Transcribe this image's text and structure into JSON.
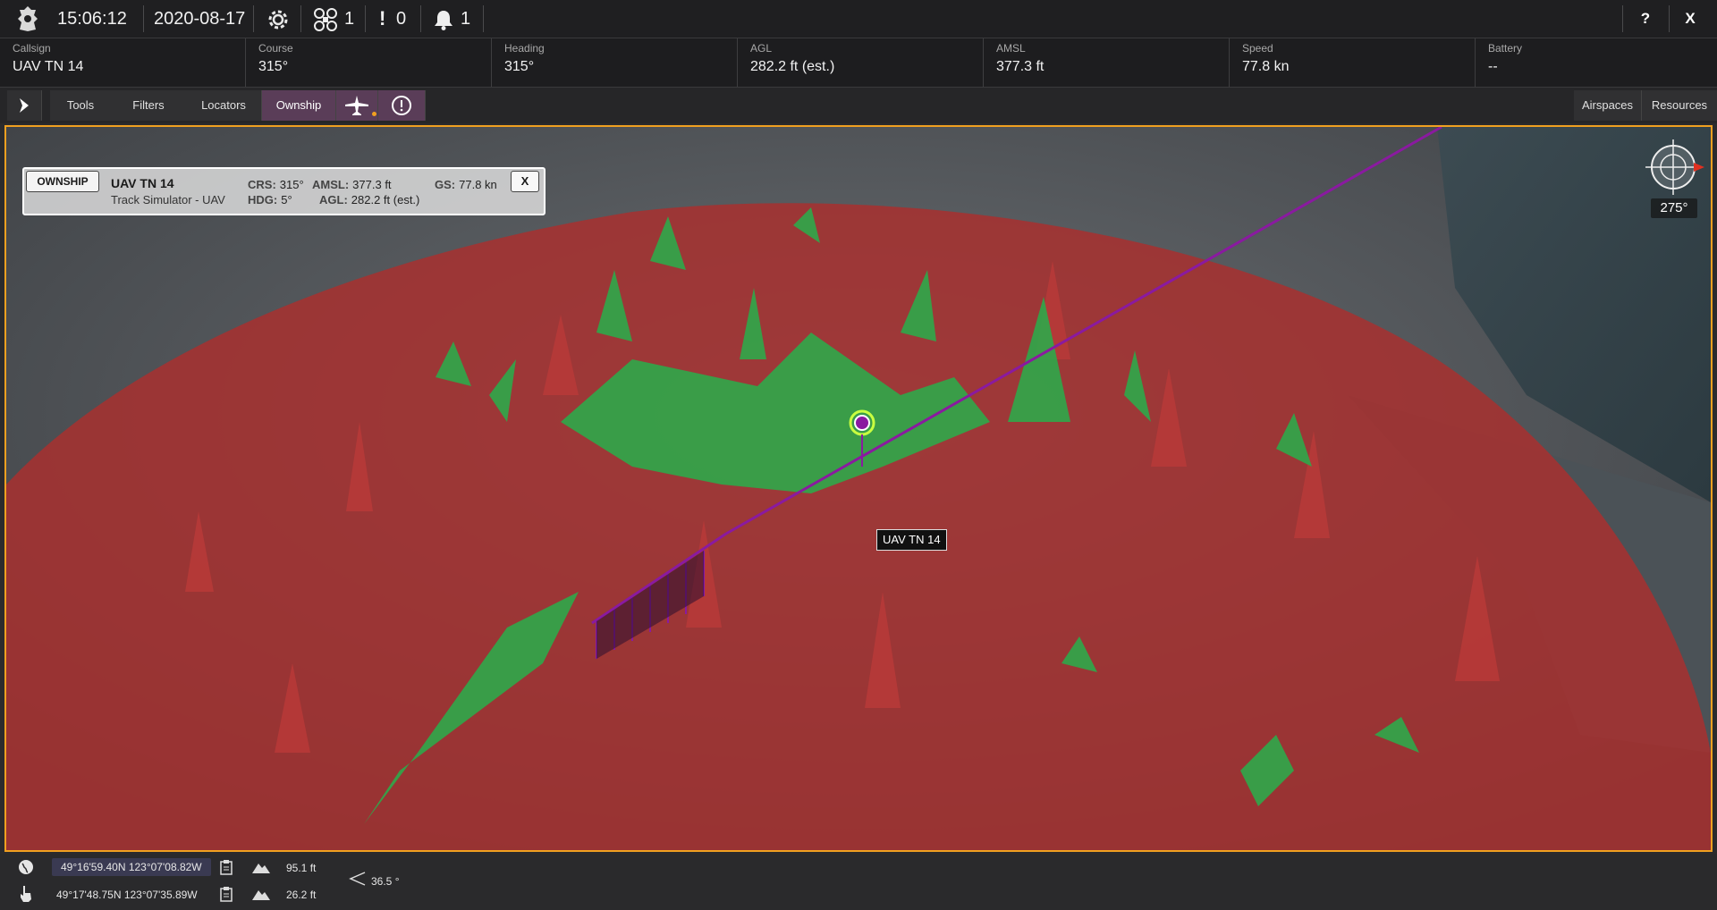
{
  "topbar": {
    "time": "15:06:12",
    "date": "2020-08-17",
    "drone_count": "1",
    "alert_count": "0",
    "notification_count": "1",
    "help_label": "?",
    "close_label": "X"
  },
  "info": {
    "callsign_label": "Callsign",
    "callsign": "UAV TN 14",
    "course_label": "Course",
    "course": "315°",
    "heading_label": "Heading",
    "heading": "315°",
    "agl_label": "AGL",
    "agl": "282.2 ft (est.)",
    "amsl_label": "AMSL",
    "amsl": "377.3 ft",
    "speed_label": "Speed",
    "speed": "77.8 kn",
    "battery_label": "Battery",
    "battery": "--"
  },
  "toolbar": {
    "tabs": [
      "Tools",
      "Filters",
      "Locators",
      "Ownship"
    ],
    "active_tab": "Ownship",
    "right_tabs": [
      "Airspaces",
      "Resources"
    ]
  },
  "ownship_panel": {
    "tag": "OWNSHIP",
    "name": "UAV TN 14",
    "source": "Track Simulator - UAV",
    "crs_label": "CRS:",
    "crs": "315°",
    "hdg_label": "HDG:",
    "hdg": "5°",
    "amsl_label": "AMSL:",
    "amsl": "377.3 ft",
    "agl_label": "AGL:",
    "agl": "282.2 ft (est.)",
    "gs_label": "GS:",
    "gs": "77.8 kn",
    "close_label": "X"
  },
  "map": {
    "compass_bearing": "275°",
    "vehicle_label": "UAV TN 14",
    "colors": {
      "viewshed_red": "#a8302f",
      "visible_green": "#2fa84a",
      "track_purple": "#8a1aa0",
      "border_orange": "#f0a020"
    }
  },
  "bottom": {
    "cursor_coords": "49°16'59.40N 123°07'08.82W",
    "cursor_elevation": "95.1 ft",
    "touch_coords": "49°17'48.75N 123°07'35.89W",
    "touch_elevation": "26.2 ft",
    "pitch": "36.5 °"
  },
  "icons": [
    "crest-icon",
    "gear-icon",
    "drone-icon",
    "exclamation-icon",
    "bell-icon",
    "chevron-right-icon",
    "aircraft-icon",
    "alert-circle-icon",
    "globe-icon",
    "pointer-hand-icon",
    "clipboard-icon",
    "mountain-icon",
    "angle-icon",
    "compass-icon"
  ]
}
